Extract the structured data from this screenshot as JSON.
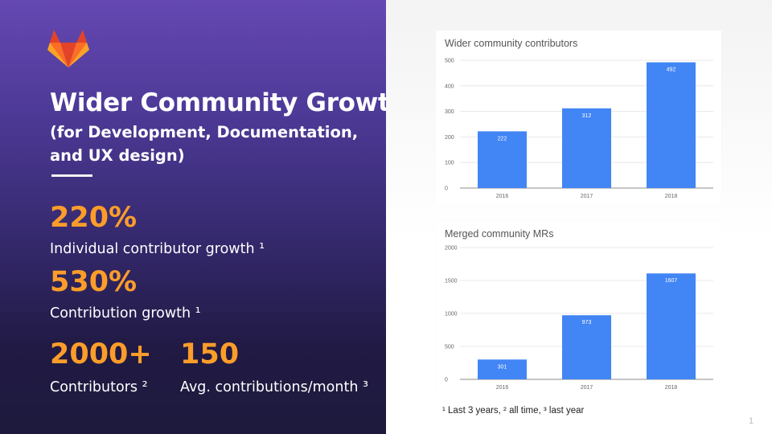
{
  "slide": {
    "title": "Wider Community Growth",
    "subtitle": "(for Development, Documentation, and UX design)",
    "page_number": "1",
    "footnote": "¹ Last 3 years,  ² all time, ³ last year"
  },
  "stats": [
    {
      "value": "220%",
      "label": "Individual contributor growth ¹"
    },
    {
      "value": "530%",
      "label": "Contribution growth ¹"
    },
    {
      "value": "2000+",
      "label": "Contributors ²"
    },
    {
      "value": "150",
      "label": "Avg. contributions/month ³"
    }
  ],
  "colors": {
    "accent": "#fc9d2a",
    "bar": "#4285f4",
    "panel_top": "#6548b2",
    "panel_bottom": "#1d1a3d"
  },
  "icons": {
    "logo": "gitlab-fox-logo"
  },
  "chart_data": [
    {
      "type": "bar",
      "title": "Wider community contributors",
      "categories": [
        "2016",
        "2017",
        "2018"
      ],
      "values": [
        222,
        312,
        492
      ],
      "ylim": [
        0,
        500
      ],
      "yticks": [
        0,
        100,
        200,
        300,
        400,
        500
      ],
      "xlabel": "",
      "ylabel": "",
      "grid": true
    },
    {
      "type": "bar",
      "title": "Merged community MRs",
      "categories": [
        "2016",
        "2017",
        "2018"
      ],
      "values": [
        301,
        973,
        1607
      ],
      "ylim": [
        0,
        2000
      ],
      "yticks": [
        0,
        500,
        1000,
        1500,
        2000
      ],
      "xlabel": "",
      "ylabel": "",
      "grid": true
    }
  ]
}
